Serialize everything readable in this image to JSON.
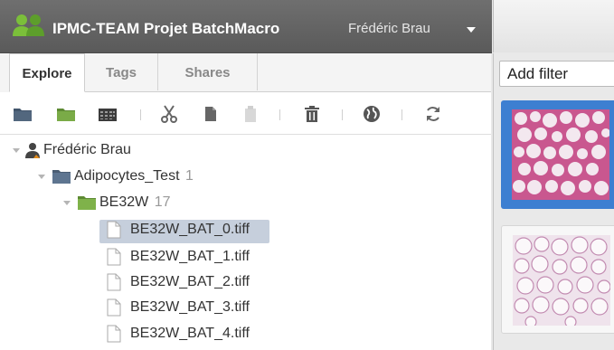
{
  "header": {
    "title": "IPMC-TEAM Projet BatchMacro",
    "user_menu": "Frédéric Brau",
    "logo_icon": "users-icon"
  },
  "tabs": [
    {
      "label": "Explore",
      "active": true
    },
    {
      "label": "Tags",
      "active": false
    },
    {
      "label": "Shares",
      "active": false
    }
  ],
  "toolbar": {
    "icons": [
      "new-project-icon",
      "new-dataset-icon",
      "new-screen-icon",
      "cut-icon",
      "copy-icon",
      "paste-icon",
      "delete-icon",
      "globe-icon",
      "refresh-icon"
    ]
  },
  "tree": {
    "user": "Frédéric Brau",
    "project": {
      "name": "Adipocytes_Test",
      "count": "1"
    },
    "dataset": {
      "name": "BE32W",
      "count": "17"
    },
    "images": [
      "BE32W_BAT_0.tiff",
      "BE32W_BAT_1.tiff",
      "BE32W_BAT_2.tiff",
      "BE32W_BAT_3.tiff",
      "BE32W_BAT_4.tiff"
    ]
  },
  "right_panel": {
    "filter_label": "Add filter"
  },
  "colors": {
    "header_bg": "#5f5f5f",
    "selection_blue": "#3d7fd1",
    "dataset_green": "#7fb24a",
    "project_folder": "#4a5d73"
  }
}
